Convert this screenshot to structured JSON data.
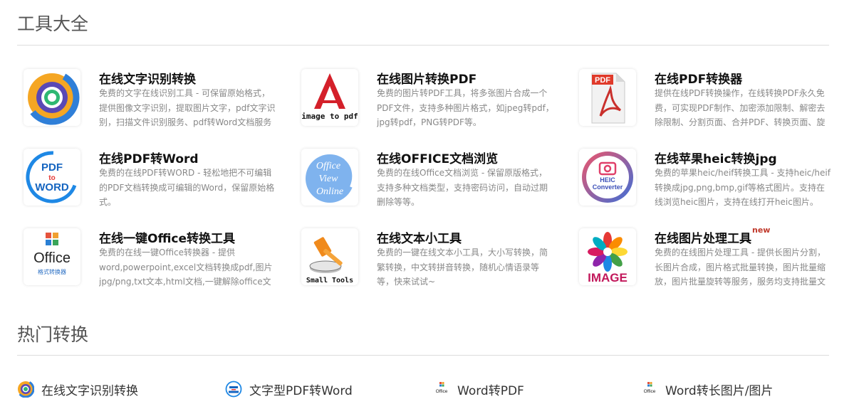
{
  "sections": {
    "tools_title": "工具大全",
    "hot_title": "热门转换"
  },
  "tools": [
    {
      "title": "在线文字识别转换",
      "desc": "免费的文字在线识别工具 - 可保留原始格式，提供图像文字识别，提取图片文字，pdf文字识别，扫描文件识别服务、pdf转Word文档服务",
      "icon": "ocr-ring-icon"
    },
    {
      "title": "在线图片转换PDF",
      "desc": "免费的图片转PDF工具，将多张图片合成一个PDF文件，支持多种图片格式，如jpeg转pdf，jpg转pdf，PNG转PDF等。",
      "icon": "image-to-pdf-icon",
      "icon_text": "image to pdf"
    },
    {
      "title": "在线PDF转换器",
      "desc": "提供在线PDF转换操作，在线转换PDF永久免费，可实现PDF制作、加密添加限制、解密去除限制、分割页面、合并PDF、转换页面、旋转页面",
      "icon": "pdf-document-icon",
      "icon_text": "PDF"
    },
    {
      "title": "在线PDF转Word",
      "desc": "免费的在线PDF转WORD - 轻松地把不可编辑的PDF文档转换成可编辑的Word，保留原始格式。",
      "icon": "pdf-to-word-icon",
      "icon_lines": [
        "PDF",
        "to",
        "WORD"
      ]
    },
    {
      "title": "在线OFFICE文档浏览",
      "desc": "免费的在线Office文档浏览 - 保留原版格式，支持多种文档类型，支持密码访问，自动过期删除等等。",
      "icon": "office-view-online-icon",
      "icon_lines": [
        "Office",
        "View",
        "Online"
      ]
    },
    {
      "title": "在线苹果heic转换jpg",
      "desc": "免费的苹果heic/heif转换工具 - 支持heic/heif转换成jpg,png,bmp,gif等格式图片。支持在线浏览heic图片，支持在线打开heic图片。",
      "icon": "heic-converter-icon",
      "icon_lines": [
        "HEIC",
        "Converter"
      ]
    },
    {
      "title": "在线一键Office转换工具",
      "desc": "免费的在线一键Office转换器 - 提供word,powerpoint,excel文档转换成pdf,图片jpg/png,txt文本,html文档,一键解除office文档",
      "icon": "office-converter-icon",
      "icon_lines": [
        "Office",
        "格式转换器"
      ]
    },
    {
      "title": "在线文本小工具",
      "desc": "免费的一键在线文本小工具，大小写转换，简繁转换，中文转拼音转换，随机心情语录等等，快来试试~",
      "icon": "small-tools-hammer-icon",
      "icon_text": "Small Tools"
    },
    {
      "title": "在线图片处理工具",
      "badge": "new",
      "desc": "免费的在线图片处理工具 - 提供长图片分割，长图片合成，图片格式批量转换，图片批量缩放，图片批量旋转等服务，服务均支持批量文件",
      "icon": "image-flower-icon",
      "icon_text": "IMAGE"
    }
  ],
  "hot": [
    {
      "label": "在线文字识别转换",
      "icon": "ocr-ring-icon"
    },
    {
      "label": "文字型PDF转Word",
      "icon": "pdf-to-word-icon"
    },
    {
      "label": "Word转PDF",
      "icon": "office-small-icon",
      "icon_text": "Office"
    },
    {
      "label": "Word转长图片/图片",
      "icon": "office-small-icon",
      "icon_text": "Office"
    }
  ]
}
